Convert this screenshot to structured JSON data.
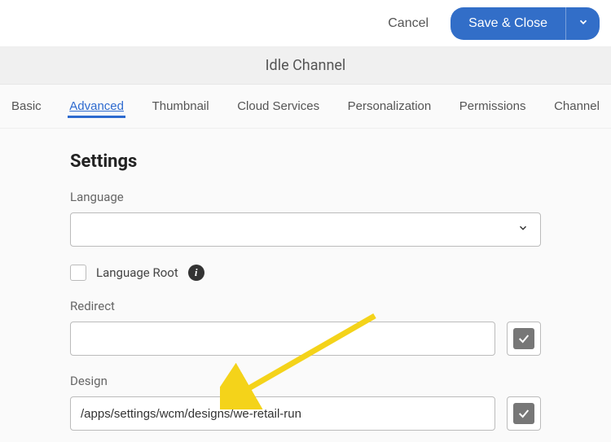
{
  "actions": {
    "cancel": "Cancel",
    "save": "Save & Close"
  },
  "page_title": "Idle Channel",
  "tabs": [
    {
      "label": "Basic",
      "active": false
    },
    {
      "label": "Advanced",
      "active": true
    },
    {
      "label": "Thumbnail",
      "active": false
    },
    {
      "label": "Cloud Services",
      "active": false
    },
    {
      "label": "Personalization",
      "active": false
    },
    {
      "label": "Permissions",
      "active": false
    },
    {
      "label": "Channel",
      "active": false
    }
  ],
  "form": {
    "section_heading": "Settings",
    "language": {
      "label": "Language",
      "value": ""
    },
    "language_root": {
      "label": "Language Root",
      "checked": false
    },
    "redirect": {
      "label": "Redirect",
      "value": "",
      "toggle_checked": true
    },
    "design": {
      "label": "Design",
      "value": "/apps/settings/wcm/designs/we-retail-run",
      "toggle_checked": true
    }
  }
}
